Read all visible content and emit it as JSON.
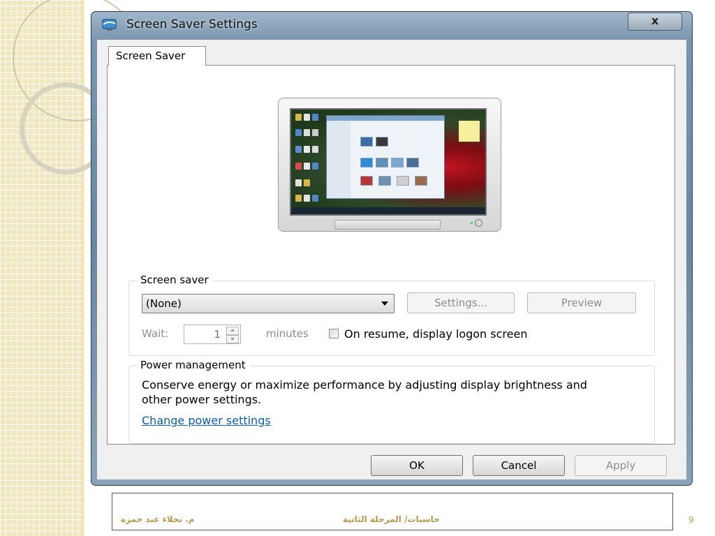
{
  "window": {
    "title": "Screen Saver Settings",
    "close_label": "x"
  },
  "tabs": [
    {
      "label": "Screen Saver",
      "selected": true
    }
  ],
  "screen_saver_group": {
    "legend": "Screen saver",
    "selected_saver": "(None)",
    "settings_label": "Settings...",
    "preview_label": "Preview",
    "wait_label": "Wait:",
    "wait_value": "1",
    "minutes_label": "minutes",
    "resume_label": "On resume, display logon screen",
    "resume_checked": false
  },
  "power_group": {
    "legend": "Power management",
    "description": "Conserve energy or maximize performance by adjusting display brightness and other power settings.",
    "link_label": "Change power settings"
  },
  "dialog_buttons": {
    "ok_label": "OK",
    "cancel_label": "Cancel",
    "apply_label": "Apply"
  },
  "slide_footer": {
    "author": "م. نجلاء عبد حمزة",
    "course": "حاسبات/ المرحلة الثانية",
    "page_number": "9"
  },
  "colors": {
    "link": "#0a5fb4",
    "footer_text": "#b8974a",
    "disabled_text": "#8d8d8d"
  }
}
